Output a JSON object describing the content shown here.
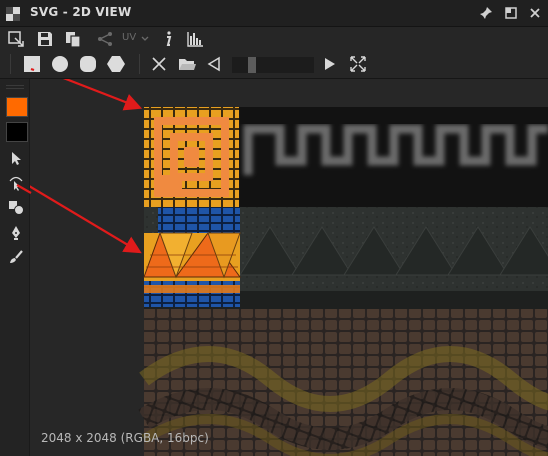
{
  "window": {
    "title": "SVG - 2D VIEW"
  },
  "toolbar": {
    "uv_label": "UV",
    "icons_row1": [
      "export-icon",
      "save-icon",
      "copy-icon",
      "share-icon",
      "uv-dropdown",
      "info-icon",
      "histogram-icon"
    ],
    "icons_row2": [
      "rectangle-shape-icon",
      "circle-shape-icon",
      "rounded-rectangle-icon",
      "polygon-icon",
      "delete-icon",
      "folder-icon",
      "previous-icon",
      "next-icon",
      "fit-view-icon"
    ]
  },
  "colors": {
    "foreground": "#ff6a00",
    "background": "#000000",
    "annotation_arrow": "#e01b1b"
  },
  "status": {
    "resolution": "2048 x 2048 (RGBA, 16bpc)"
  }
}
